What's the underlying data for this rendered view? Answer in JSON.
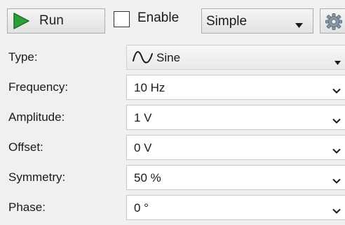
{
  "toolbar": {
    "run_label": "Run",
    "enable_label": "Enable",
    "enable_checked": false,
    "mode_value": "Simple"
  },
  "colors": {
    "play_icon": "#2e9e3c",
    "play_icon_border": "#1d6e27"
  },
  "properties": [
    {
      "label": "Type:",
      "value": "Sine",
      "icon": "sine-wave-icon",
      "control": "dropdown"
    },
    {
      "label": "Frequency:",
      "value": "10 Hz",
      "control": "combo"
    },
    {
      "label": "Amplitude:",
      "value": "1 V",
      "control": "combo"
    },
    {
      "label": "Offset:",
      "value": "0 V",
      "control": "combo"
    },
    {
      "label": "Symmetry:",
      "value": "50 %",
      "control": "combo"
    },
    {
      "label": "Phase:",
      "value": "0 °",
      "control": "combo"
    }
  ]
}
